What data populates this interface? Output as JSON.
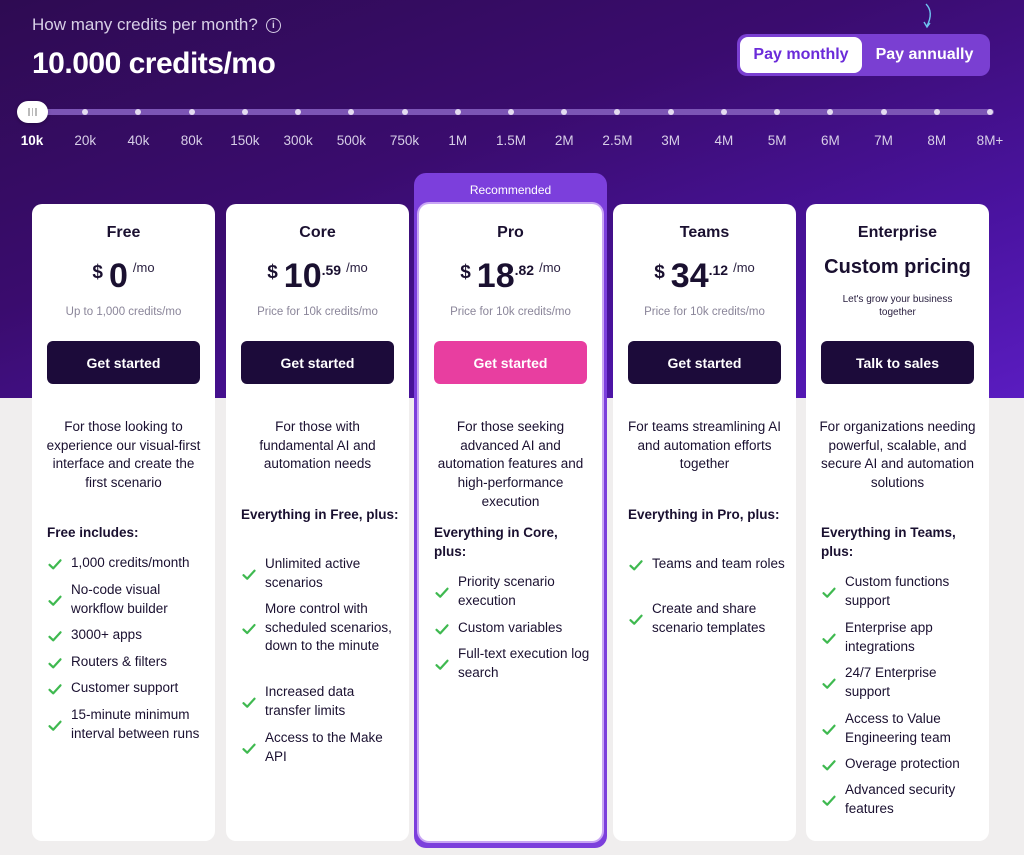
{
  "header": {
    "question": "How many credits per month?",
    "info_icon": "ⓘ",
    "selected_credits": "10.000 credits/mo"
  },
  "billing_toggle": {
    "monthly": "Pay monthly",
    "annually": "Pay annually",
    "selected": "monthly"
  },
  "slider": {
    "ticks": [
      "10k",
      "20k",
      "40k",
      "80k",
      "150k",
      "300k",
      "500k",
      "750k",
      "1M",
      "1.5M",
      "2M",
      "2.5M",
      "3M",
      "4M",
      "5M",
      "6M",
      "7M",
      "8M",
      "8M+"
    ],
    "selected_index": 0
  },
  "recommended_label": "Recommended",
  "colors": {
    "accent_purple": "#6b2bd9",
    "cta_dark": "#1c0b3a",
    "cta_pink": "#e83ea0",
    "check_green": "#3fb950"
  },
  "plans": [
    {
      "name": "Free",
      "currency": "$",
      "price_int": "0",
      "price_dec": "",
      "per": "/mo",
      "note": "Up to 1,000 credits/mo",
      "cta": "Get started",
      "description": "For those looking to experience our visual-first interface and create the first scenario",
      "includes_heading": "Free includes:",
      "features": [
        "1,000 credits/month",
        "No-code visual workflow builder",
        "3000+ apps",
        "Routers & filters",
        "Customer support",
        "15-minute minimum interval between runs"
      ]
    },
    {
      "name": "Core",
      "currency": "$",
      "price_int": "10",
      "price_dec": ".59",
      "per": "/mo",
      "note": "Price for 10k credits/mo",
      "cta": "Get started",
      "description": "For those with fundamental AI and automation needs",
      "includes_heading": "Everything in Free, plus:",
      "features": [
        "Unlimited active scenarios",
        "More control with scheduled scenarios, down to the minute",
        "Increased data transfer limits",
        "Access to the Make API"
      ]
    },
    {
      "name": "Pro",
      "currency": "$",
      "price_int": "18",
      "price_dec": ".82",
      "per": "/mo",
      "note": "Price for 10k credits/mo",
      "cta": "Get started",
      "description": "For those seeking advanced AI and automation features and high-performance execution",
      "includes_heading": "Everything in Core, plus:",
      "features": [
        "Priority scenario execution",
        "Custom variables",
        "Full-text execution log search"
      ]
    },
    {
      "name": "Teams",
      "currency": "$",
      "price_int": "34",
      "price_dec": ".12",
      "per": "/mo",
      "note": "Price for 10k credits/mo",
      "cta": "Get started",
      "description": "For teams streamlining AI and automation efforts together",
      "includes_heading": "Everything in Pro, plus:",
      "features": [
        "Teams and team roles",
        "Create and share scenario templates"
      ]
    },
    {
      "name": "Enterprise",
      "custom_pricing": "Custom pricing",
      "subtitle": "Let's grow your business together",
      "cta": "Talk to sales",
      "description": "For organizations needing powerful, scalable, and secure AI and automation solutions",
      "includes_heading": "Everything in Teams, plus:",
      "features": [
        "Custom functions support",
        "Enterprise app integrations",
        "24/7 Enterprise support",
        "Access to Value Engineering team",
        "Overage protection",
        "Advanced security features"
      ]
    }
  ]
}
